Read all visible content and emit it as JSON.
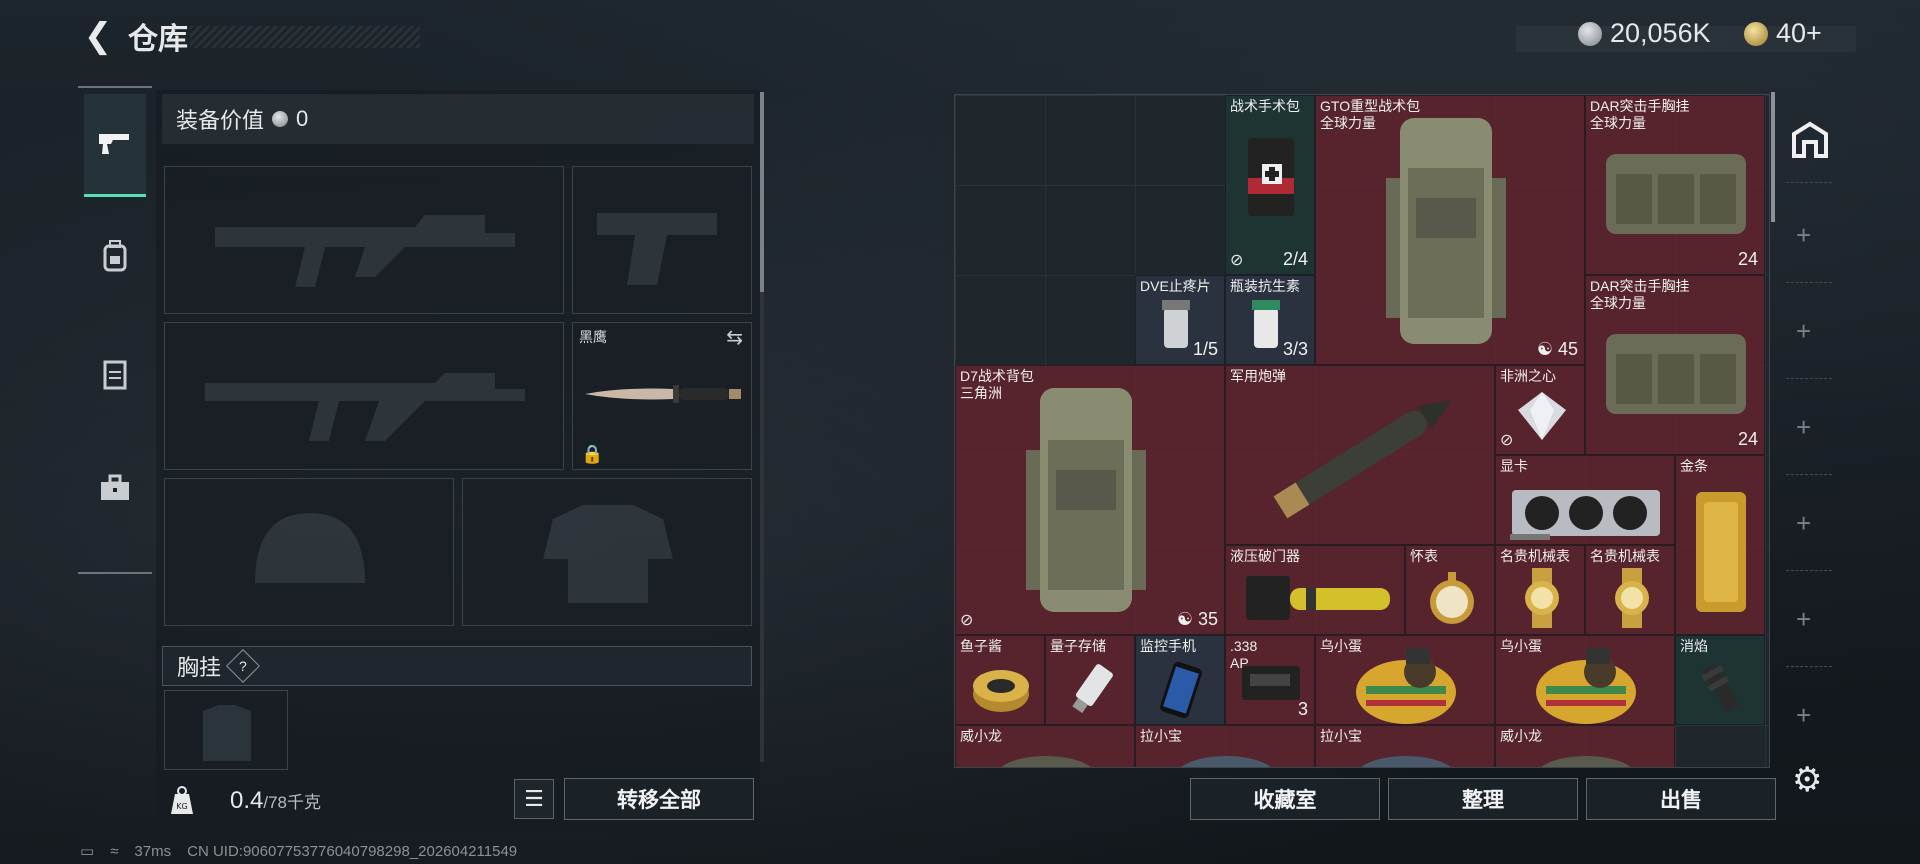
{
  "header": {
    "title": "仓库",
    "currency_1": "20,056K",
    "currency_2": "40+"
  },
  "left": {
    "tabs": [
      "gun-icon",
      "backpack-icon",
      "vest-icon",
      "toolbox-icon"
    ],
    "equip_value_label": "装备价值",
    "equip_value": "0",
    "knife_label": "黑鹰",
    "chest_label": "胸挂",
    "chest_hint": "?",
    "weight_value": "0.4",
    "weight_max": "/78千克",
    "transfer_all": "转移全部"
  },
  "grid": {
    "items": [
      {
        "name": "战术手术包",
        "count": "2/4"
      },
      {
        "name": "GTO重型战术包\n全球力量",
        "count": "45"
      },
      {
        "name": "DAR突击手胸挂\n全球力量",
        "count": "24"
      },
      {
        "name": "DVE止疼片",
        "count": "1/5"
      },
      {
        "name": "瓶装抗生素",
        "count": "3/3"
      },
      {
        "name": "DAR突击手胸挂\n全球力量",
        "count": "24"
      },
      {
        "name": "D7战术背包\n三角洲",
        "count": "35"
      },
      {
        "name": "军用炮弹",
        "count": ""
      },
      {
        "name": "非洲之心",
        "count": ""
      },
      {
        "name": "显卡",
        "count": ""
      },
      {
        "name": "金条",
        "count": ""
      },
      {
        "name": "液压破门器",
        "count": ""
      },
      {
        "name": "怀表",
        "count": ""
      },
      {
        "name": "名贵机械表",
        "count": ""
      },
      {
        "name": "名贵机械表",
        "count": ""
      },
      {
        "name": "鱼子酱",
        "count": ""
      },
      {
        "name": "量子存储",
        "count": ""
      },
      {
        "name": "监控手机",
        "count": ""
      },
      {
        "name": ".338\nAP",
        "count": "3"
      },
      {
        "name": "乌小蛋",
        "count": ""
      },
      {
        "name": "乌小蛋",
        "count": ""
      },
      {
        "name": "消焰",
        "count": ""
      },
      {
        "name": "威小龙",
        "count": ""
      },
      {
        "name": "拉小宝",
        "count": ""
      },
      {
        "name": "拉小宝",
        "count": ""
      },
      {
        "name": "威小龙",
        "count": ""
      }
    ]
  },
  "actions": {
    "collection": "收藏室",
    "sort": "整理",
    "sell": "出售"
  },
  "status": {
    "ping": "37ms",
    "uid": "CN UID:9060775377604079829​8_202604211549"
  },
  "colors": {
    "accent": "#56e0b5",
    "item_red": "#6e222c",
    "item_slate": "#2d3442"
  }
}
